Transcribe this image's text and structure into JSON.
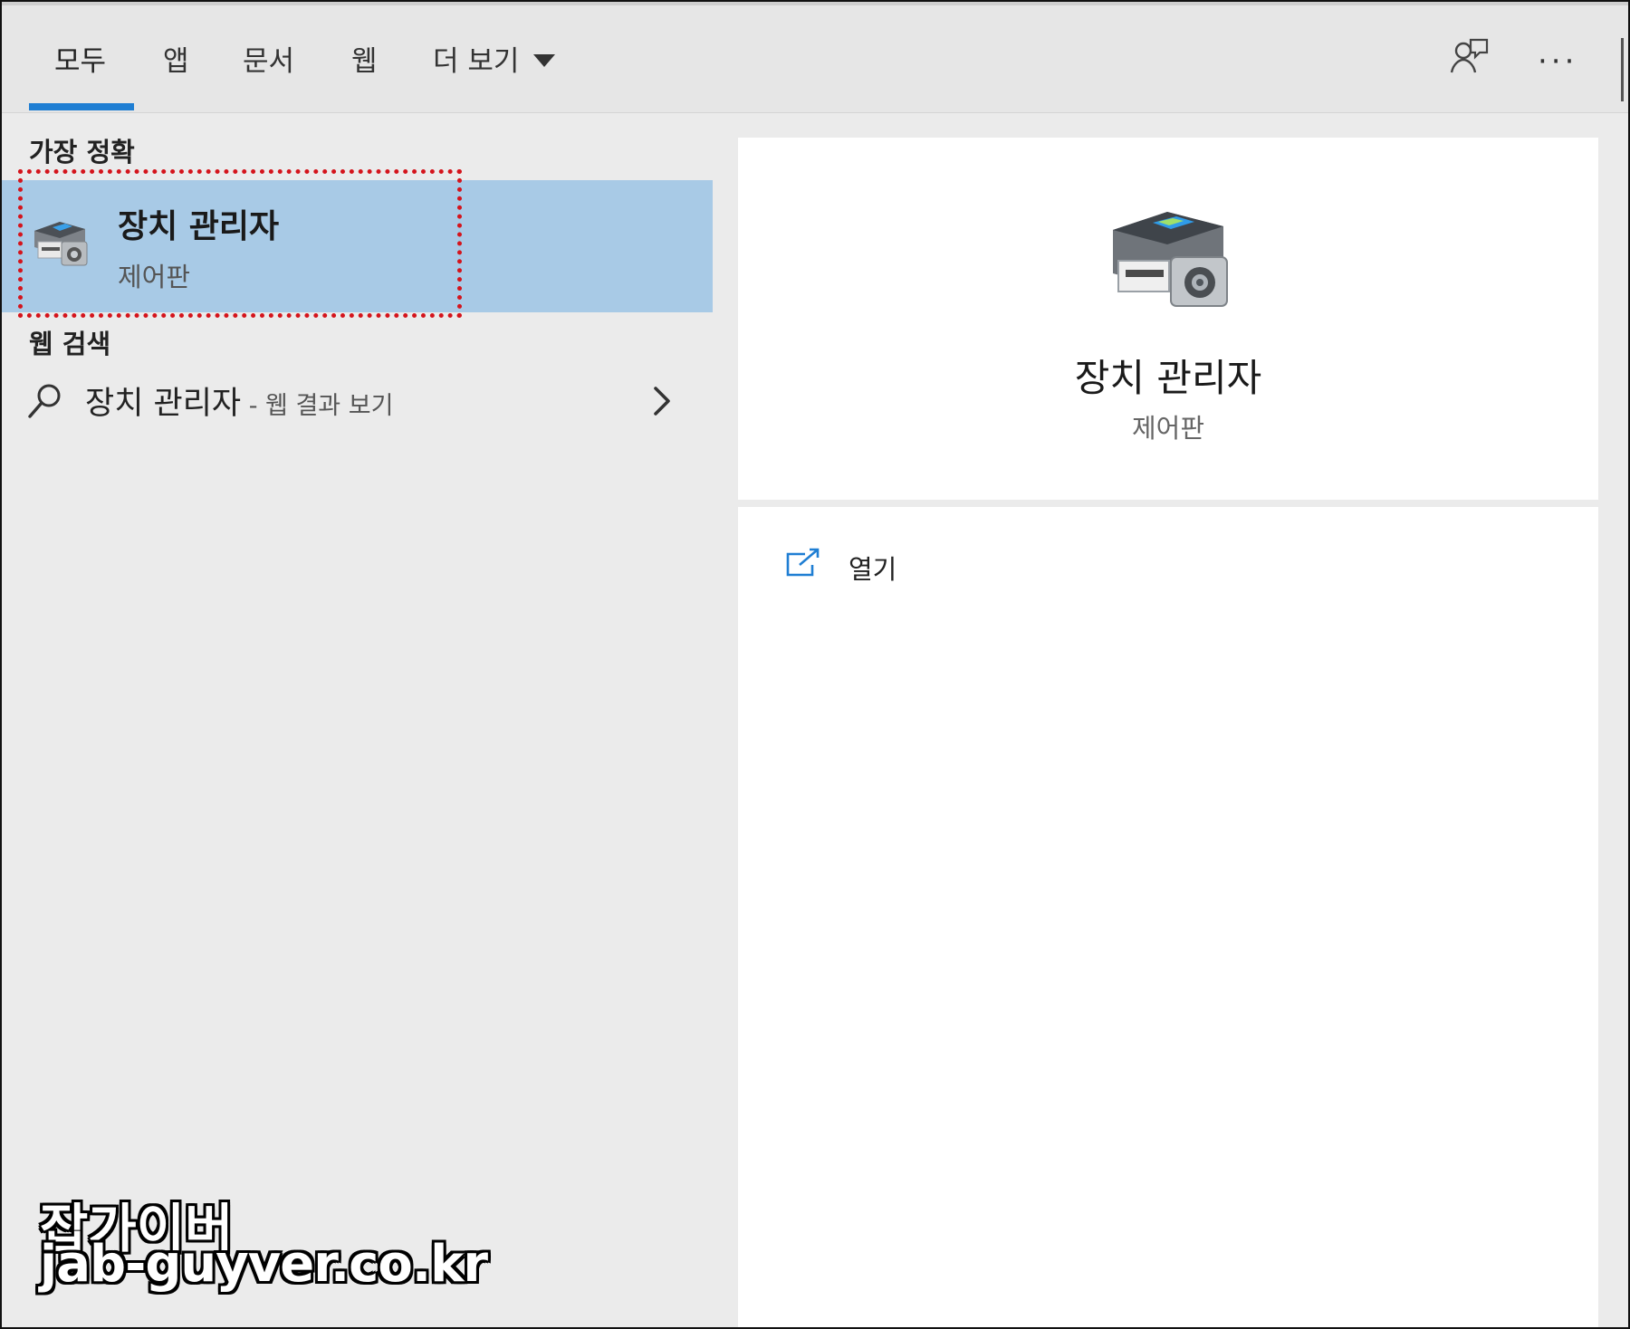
{
  "tabs": [
    {
      "label": "모두",
      "active": true
    },
    {
      "label": "앱"
    },
    {
      "label": "문서"
    },
    {
      "label": "웹"
    },
    {
      "label": "더 보기"
    }
  ],
  "toolbar": {
    "feedback_icon": "feedback-icon",
    "more_icon": "ellipsis-icon",
    "more_label": "···"
  },
  "left": {
    "best_match_header": "가장 정확",
    "best_match": {
      "title": "장치 관리자",
      "subtitle": "제어판",
      "icon": "device-manager-icon"
    },
    "web_search_header": "웹 검색",
    "web_result": {
      "query": "장치 관리자",
      "suffix": " - 웹 결과 보기",
      "icon": "search-icon",
      "chevron": "chevron-right-icon"
    }
  },
  "detail": {
    "title": "장치 관리자",
    "subtitle": "제어판",
    "icon": "device-manager-icon"
  },
  "actions": [
    {
      "label": "열기",
      "icon": "open-external-icon"
    }
  ],
  "watermark": {
    "line1": "잡가이버",
    "line2": "jab-guyver.co.kr"
  },
  "colors": {
    "accent": "#1f7ed3",
    "selection": "#a8cae6",
    "highlight_box": "#d4141c"
  }
}
